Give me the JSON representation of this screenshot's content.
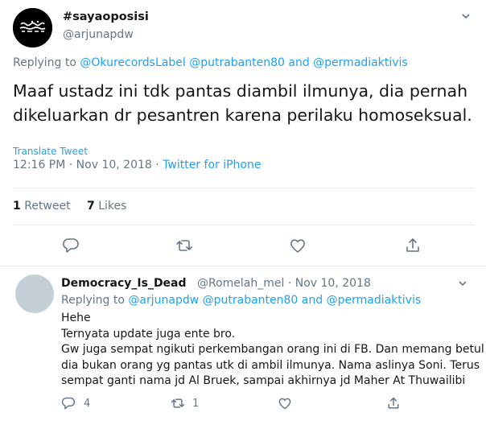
{
  "main_tweet": {
    "display_name": "#sayaoposisi",
    "handle": "@arjunapdw",
    "replying_prefix": "Replying to",
    "mentions": [
      "@OkurecordsLabel",
      "@putrabanten80"
    ],
    "mentions_and": "and",
    "last_mention": "@permadiaktivis",
    "text_lines": [
      "Maaf ustadz ini tdk pantas diambil ilmunya, dia pernah",
      "dikeluarkan dr pesantren karena perilaku homoseksual."
    ],
    "translate_label": "Translate Tweet",
    "timestamp": "12:16 PM · Nov 10, 2018 ·",
    "source": "Twitter for iPhone",
    "retweet_count": "1",
    "retweet_label": "Retweet",
    "like_count": "7",
    "like_label": "Likes"
  },
  "reply_tweet": {
    "display_name": "Democracy_Is_Dead",
    "handle_time": "@Romelah_mel · Nov 10, 2018",
    "replying_prefix": "Replying to",
    "mentions": [
      "@arjunapdw",
      "@putrabanten80"
    ],
    "mentions_and": "and",
    "last_mention": "@permadiaktivis",
    "text_lines": [
      "Hehe",
      "Ternyata update juga ente bro.",
      "Gw juga sempat ngikuti perkembangan orang ini di FB. Dan memang betul",
      "dia bukan orang yg pantas utk di ambil ilmunya. Nama aslinya Soni. Terus",
      "sempat ganti nama jd Al Bruek, sampai akhirnya jd Maher At Thuwailibi"
    ],
    "reply_count": "4",
    "retweet_count": "1"
  },
  "icons": [
    "chevron-down-icon",
    "reply-icon",
    "retweet-icon",
    "like-icon",
    "share-icon"
  ],
  "colors": {
    "link": "#1da1f2",
    "secondary": "#657786",
    "text": "#14171a",
    "divider": "#e6ecf0",
    "avatar_placeholder": "#c4cfd6"
  }
}
